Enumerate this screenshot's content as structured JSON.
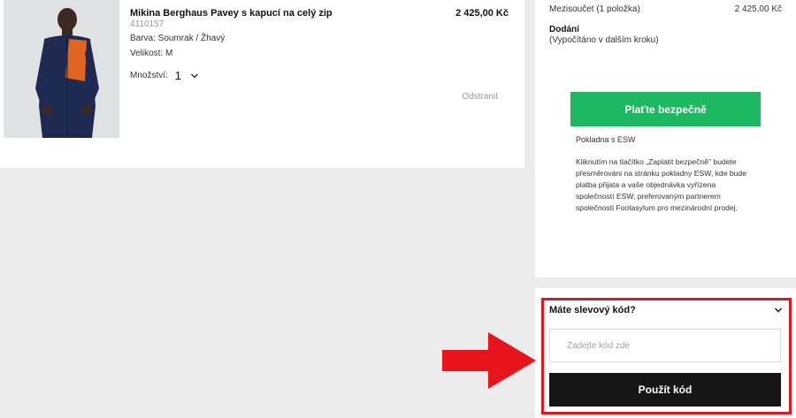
{
  "product": {
    "title": "Mikina Berghaus Pavey s kapucí na celý zip",
    "sku": "4110157",
    "color": "Barva: Soumrak / Žhavý",
    "size": "Velikost: M",
    "quantity_label": "Množství:",
    "quantity_value": "1",
    "price": "2 425,00 Kč",
    "remove_label": "Odstranit",
    "image_icon": "hoodie-photo"
  },
  "summary": {
    "subtotal_label": "Mezisoučet (1 položka)",
    "subtotal_value": "2 425,00 Kč",
    "delivery_label": "Dodání",
    "delivery_note": "(Vypočítáno v dalším kroku)",
    "pay_button": "Plaťte bezpečně",
    "checkout_label": "Pokladna s ESW",
    "disclaimer": "Kliknutím na tlačítko „Zaplatit bezpečně\" budete přesměrováni na stránku pokladny ESW, kde bude platba přijata a vaše objednávka vyřízena společností ESW, preferovaným partnerem společnosti Footasylum pro mezinárodní prodej."
  },
  "discount": {
    "title": "Máte slevový kód?",
    "input_value": "",
    "input_placeholder": "Zadejte kód zde",
    "apply_button": "Použít kód"
  },
  "colors": {
    "pay_green": "#1cb862",
    "apply_black": "#161616",
    "annotation_red": "#e8141c",
    "page_background": "#ececec"
  }
}
